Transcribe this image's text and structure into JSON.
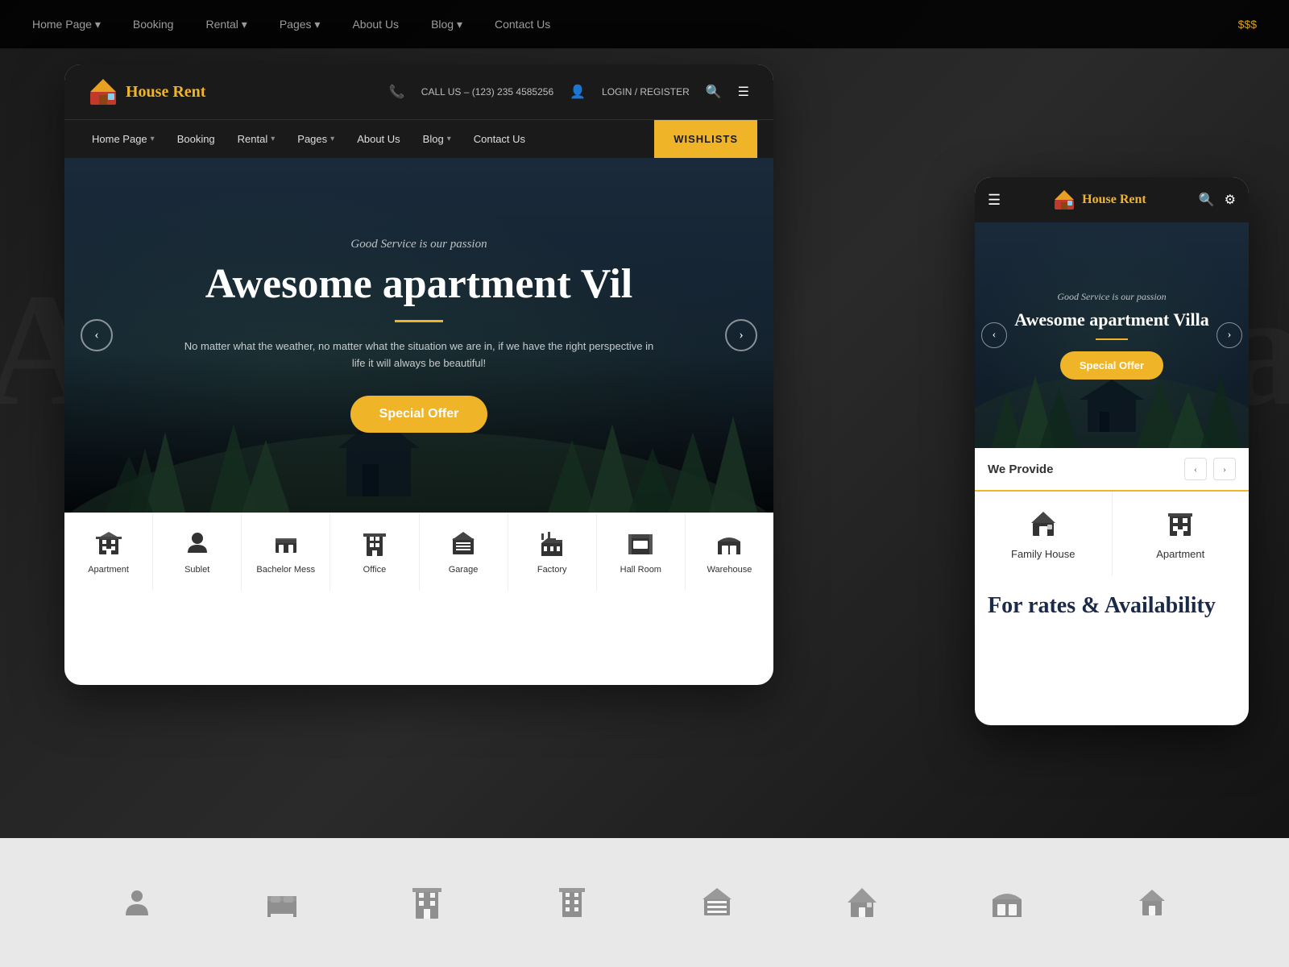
{
  "background": {
    "text_left": "A",
    "text_right": "la"
  },
  "top_bar": {
    "items": [
      {
        "label": "Home Page",
        "has_chevron": true
      },
      {
        "label": "Booking",
        "has_chevron": false
      },
      {
        "label": "Rental",
        "has_chevron": true
      },
      {
        "label": "Pages",
        "has_chevron": true
      },
      {
        "label": "About Us",
        "has_chevron": false
      },
      {
        "label": "Blog",
        "has_chevron": true
      },
      {
        "label": "Contact Us",
        "has_chevron": false
      }
    ],
    "gold_text": "$$$"
  },
  "desktop_window": {
    "header": {
      "logo_text": "House Rent",
      "phone_label": "CALL US – (123) 235 4585256",
      "login_label": "LOGIN / REGISTER",
      "phone_icon": "📞",
      "user_icon": "👤"
    },
    "nav": {
      "items": [
        {
          "label": "Home Page",
          "has_chevron": true
        },
        {
          "label": "Booking",
          "has_chevron": false
        },
        {
          "label": "Rental",
          "has_chevron": true
        },
        {
          "label": "Pages",
          "has_chevron": true
        },
        {
          "label": "About Us",
          "has_chevron": false
        },
        {
          "label": "Blog",
          "has_chevron": true
        },
        {
          "label": "Contact Us",
          "has_chevron": false
        }
      ],
      "wishlist_label": "WISHLISTS"
    },
    "hero": {
      "tagline": "Good Service is our passion",
      "title": "Awesome apartment Vil",
      "description": "No matter what the weather, no matter what the situation we are in, if we have the right perspective in life it will always be beautiful!",
      "cta_label": "Special Offer",
      "arrow_left": "‹",
      "arrow_right": "›"
    },
    "categories": [
      {
        "label": "Apartment"
      },
      {
        "label": "Sublet"
      },
      {
        "label": "Bachelor Mess"
      },
      {
        "label": "Office"
      },
      {
        "label": "Garage"
      },
      {
        "label": "Factory"
      },
      {
        "label": "Hall Room"
      },
      {
        "label": "Warehouse"
      }
    ]
  },
  "mobile_window": {
    "header": {
      "logo_text": "House Rent",
      "hamburger": "☰",
      "search_icon": "🔍",
      "filter_icon": "⚙"
    },
    "hero": {
      "tagline": "Good Service is our passion",
      "title": "Awesome apartment Villa",
      "cta_label": "Special Offer",
      "arrow_left": "‹",
      "arrow_right": "›"
    },
    "provide": {
      "title": "We Provide",
      "nav_prev": "‹",
      "nav_next": "›",
      "items": [
        {
          "label": "Family House"
        },
        {
          "label": "Apartment"
        }
      ]
    },
    "rates": {
      "title": "For rates & Availability"
    }
  },
  "bottom_bar": {
    "items": [
      {
        "label": "person"
      },
      {
        "label": "bed"
      },
      {
        "label": "building"
      },
      {
        "label": "office"
      },
      {
        "label": "garage"
      },
      {
        "label": "house"
      },
      {
        "label": "warehouse"
      }
    ]
  }
}
